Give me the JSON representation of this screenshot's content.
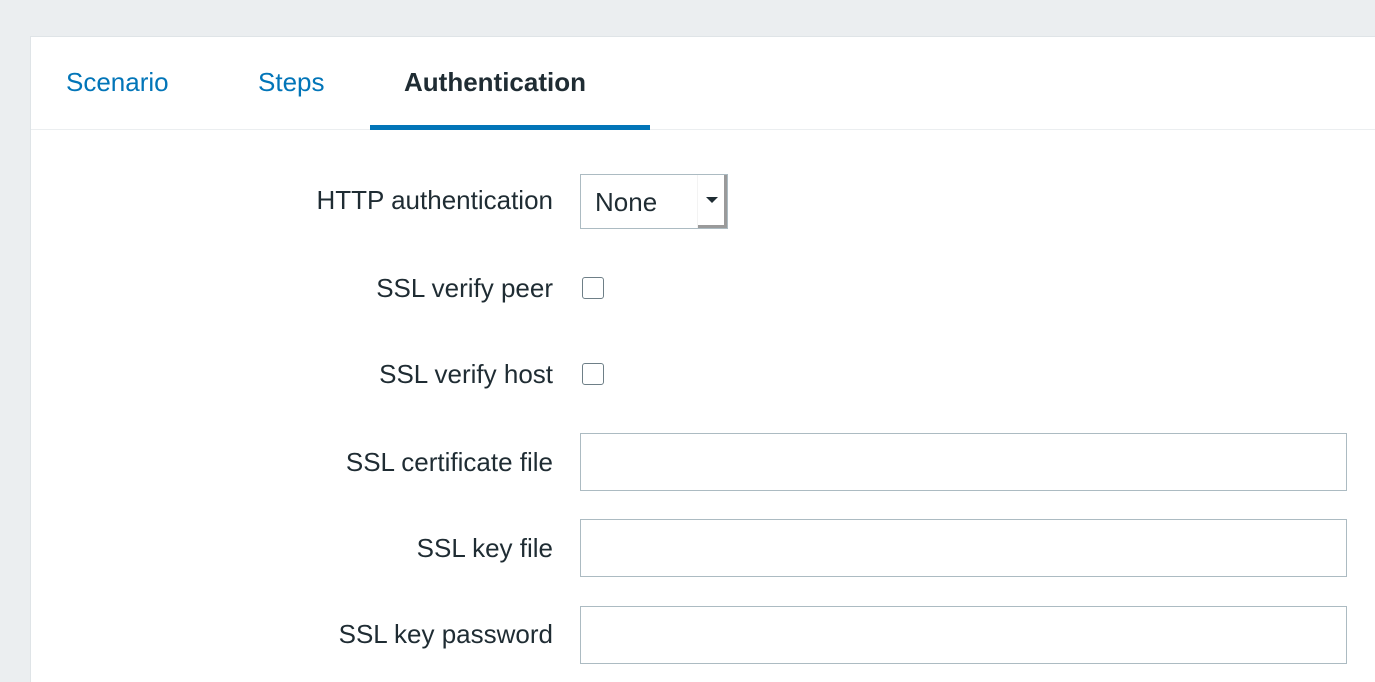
{
  "tabs": [
    {
      "label": "Scenario",
      "active": false
    },
    {
      "label": "Steps",
      "active": false
    },
    {
      "label": "Authentication",
      "active": true
    }
  ],
  "form": {
    "http_authentication": {
      "label": "HTTP authentication",
      "selected": "None"
    },
    "ssl_verify_peer": {
      "label": "SSL verify peer",
      "checked": false
    },
    "ssl_verify_host": {
      "label": "SSL verify host",
      "checked": false
    },
    "ssl_certificate_file": {
      "label": "SSL certificate file",
      "value": ""
    },
    "ssl_key_file": {
      "label": "SSL key file",
      "value": ""
    },
    "ssl_key_password": {
      "label": "SSL key password",
      "value": ""
    }
  },
  "colors": {
    "accent": "#0275b8",
    "text": "#1f2c33",
    "background": "#ebeef0",
    "border": "#acbbc2"
  }
}
